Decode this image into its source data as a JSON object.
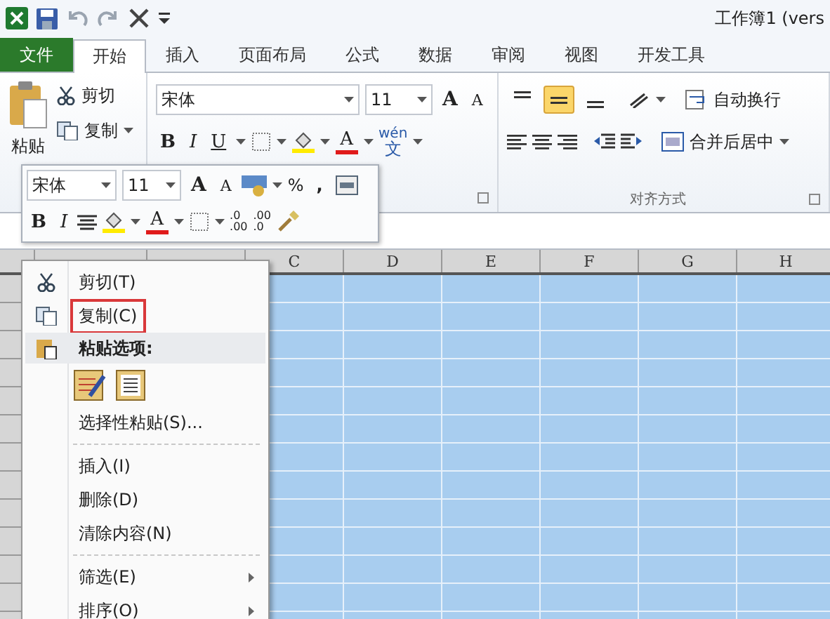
{
  "title_bar": {
    "title": "工作簿1 (vers"
  },
  "tabs": [
    {
      "label": "文件",
      "kind": "file",
      "selected": false
    },
    {
      "label": "开始",
      "kind": "tab",
      "selected": true
    },
    {
      "label": "插入",
      "kind": "tab",
      "selected": false
    },
    {
      "label": "页面布局",
      "kind": "tab",
      "selected": false
    },
    {
      "label": "公式",
      "kind": "tab",
      "selected": false
    },
    {
      "label": "数据",
      "kind": "tab",
      "selected": false
    },
    {
      "label": "审阅",
      "kind": "tab",
      "selected": false
    },
    {
      "label": "视图",
      "kind": "tab",
      "selected": false
    },
    {
      "label": "开发工具",
      "kind": "tab",
      "selected": false
    }
  ],
  "clipboard": {
    "paste": "粘贴",
    "cut": "剪切",
    "copy": "复制"
  },
  "font": {
    "name": "宋体",
    "size": "11",
    "grow": "A",
    "shrink": "A",
    "bold": "B",
    "italic": "I",
    "underline": "U",
    "color_letter": "A",
    "phonetic_top": "wén",
    "phonetic_char": "文"
  },
  "alignment": {
    "label": "对齐方式",
    "wrap_text": "自动换行",
    "merge_center": "合并后居中",
    "vertical": [
      {
        "selected": false
      },
      {
        "selected": true
      },
      {
        "selected": false
      }
    ]
  },
  "mini_toolbar": {
    "font": "宋体",
    "size": "11",
    "grow": "A",
    "shrink": "A",
    "percent": "%",
    "comma": ",",
    "bold": "B",
    "italic": "I",
    "color_letter": "A",
    "increase_decimal": [
      ".0",
      ".00"
    ],
    "decrease_decimal": [
      ".00",
      ".0"
    ]
  },
  "columns": [
    "C",
    "D",
    "E",
    "F",
    "G",
    "H"
  ],
  "context_menu": [
    {
      "kind": "item",
      "label": "剪切(T)",
      "boxed": false
    },
    {
      "kind": "item",
      "label": "复制(C)",
      "boxed": true
    },
    {
      "kind": "header",
      "label": "粘贴选项:"
    },
    {
      "kind": "paste_icons"
    },
    {
      "kind": "item",
      "label": "选择性粘贴(S)...",
      "boxed": false
    },
    {
      "kind": "separator"
    },
    {
      "kind": "item",
      "label": "插入(I)",
      "boxed": false
    },
    {
      "kind": "item",
      "label": "删除(D)",
      "boxed": false
    },
    {
      "kind": "item",
      "label": "清除内容(N)",
      "boxed": false
    },
    {
      "kind": "separator"
    },
    {
      "kind": "submenu",
      "label": "筛选(E)"
    },
    {
      "kind": "submenu",
      "label": "排序(O)"
    }
  ]
}
